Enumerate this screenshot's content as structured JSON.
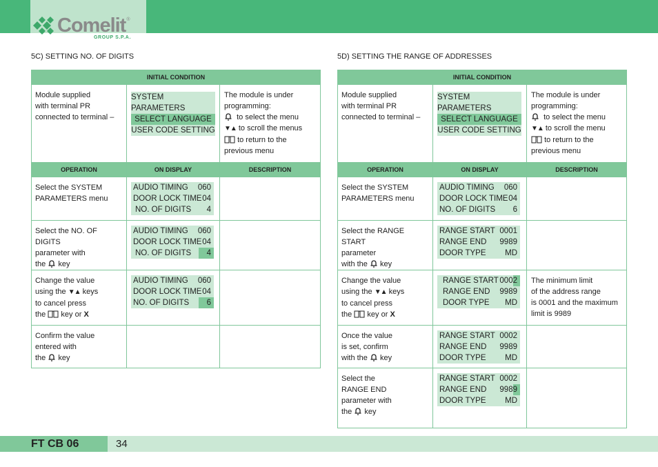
{
  "header": {
    "brand": "Comelit",
    "brand_mark": "®",
    "brand_sub": "GROUP S.P.A.",
    "colors": {
      "bar": "#48b77a",
      "logo_bg": "#bfe3cc",
      "table_header": "#80c89a",
      "lcd": "#cbe8d5"
    }
  },
  "left": {
    "title": "5C) SETTING NO. OF DIGITS",
    "initial_condition_label": "INITIAL CONDITION",
    "initial": {
      "operation": [
        "Module supplied",
        "with terminal PR",
        "connected to terminal –"
      ],
      "display": [
        "SYSTEM PARAMETERS",
        "SELECT LANGUAGE",
        "USER CODE SETTING"
      ],
      "description": [
        "The module is under",
        "programming:",
        "to select the menu",
        "to scroll the menus",
        "to return to the",
        "previous menu"
      ]
    },
    "columns": [
      "OPERATION",
      "ON DISPLAY",
      "DESCRIPTION"
    ],
    "rows": [
      {
        "operation": [
          "Select the SYSTEM",
          "PARAMETERS menu"
        ],
        "display": [
          [
            "AUDIO TIMING",
            "060"
          ],
          [
            "DOOR LOCK TIME",
            "04"
          ],
          [
            "NO. OF DIGITS",
            "4"
          ]
        ],
        "description": ""
      },
      {
        "operation": [
          "Select the NO. OF DIGITS",
          "parameter with",
          "the",
          "key"
        ],
        "display": [
          [
            "AUDIO TIMING",
            "060"
          ],
          [
            "DOOR LOCK TIME",
            "04"
          ],
          [
            "NO. OF DIGITS",
            "4"
          ]
        ],
        "description": ""
      },
      {
        "operation": [
          "Change the value",
          "using the",
          "keys",
          "to cancel press",
          "the",
          "key or",
          "X"
        ],
        "display": [
          [
            "AUDIO TIMING",
            "060"
          ],
          [
            "DOOR LOCK TIME",
            "04"
          ],
          [
            "NO. OF DIGITS",
            "6"
          ]
        ],
        "description": ""
      },
      {
        "operation": [
          "Confirm the value",
          "entered with",
          "the",
          "key"
        ],
        "display": [],
        "description": ""
      }
    ]
  },
  "right": {
    "title": "5D) SETTING THE RANGE OF ADDRESSES",
    "initial_condition_label": "INITIAL CONDITION",
    "initial": {
      "operation": [
        "Module supplied",
        "with terminal PR",
        "connected to terminal –"
      ],
      "display": [
        "SYSTEM PARAMETERS",
        "SELECT LANGUAGE",
        "USER CODE SETTING"
      ],
      "description": [
        "The module is under",
        "programming:",
        "to select the menu",
        "to scroll the menu",
        "to return to the",
        "previous menu"
      ]
    },
    "columns": [
      "OPERATION",
      "ON DISPLAY",
      "DESCRIPTION"
    ],
    "rows": [
      {
        "operation": [
          "Select the SYSTEM",
          "PARAMETERS menu"
        ],
        "display": [
          [
            "AUDIO TIMING",
            "060"
          ],
          [
            "DOOR LOCK TIME",
            "04"
          ],
          [
            "NO. OF DIGITS",
            "6"
          ]
        ],
        "description": []
      },
      {
        "operation": [
          "Select the RANGE START",
          "parameter",
          "with the",
          "key"
        ],
        "display": [
          [
            "RANGE START",
            "0001"
          ],
          [
            "RANGE END",
            "9989"
          ],
          [
            "DOOR TYPE",
            "MD"
          ]
        ],
        "description": []
      },
      {
        "operation": [
          "Change the value",
          "using the",
          "keys",
          "to cancel press",
          "the",
          "key or",
          "X"
        ],
        "display": [
          [
            "RANGE START",
            "000",
            "2"
          ],
          [
            "RANGE END",
            "9989"
          ],
          [
            "DOOR TYPE",
            "MD"
          ]
        ],
        "description": [
          "The minimum limit",
          "of the address range",
          "is 0001 and the maximum",
          "limit is 9989"
        ]
      },
      {
        "operation": [
          "Once the  value",
          "is set, confirm",
          "with the",
          "key"
        ],
        "display": [
          [
            "RANGE START",
            "0002"
          ],
          [
            "RANGE END",
            "9989"
          ],
          [
            "DOOR TYPE",
            "MD"
          ]
        ],
        "description": []
      },
      {
        "operation": [
          "Select the",
          "RANGE END",
          "parameter with",
          "the",
          "key"
        ],
        "display": [
          [
            "RANGE START",
            "0002"
          ],
          [
            "RANGE END",
            "998",
            "9"
          ],
          [
            "DOOR TYPE",
            "MD"
          ]
        ],
        "description": []
      }
    ]
  },
  "footer": {
    "code": "FT CB 06",
    "page": "34"
  }
}
